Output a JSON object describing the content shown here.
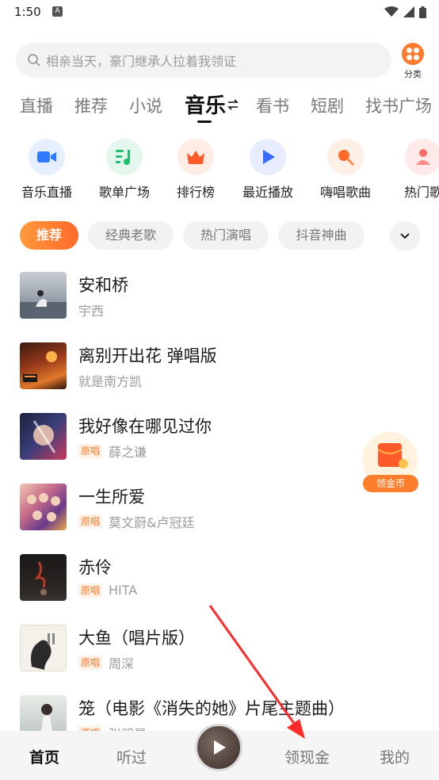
{
  "status_bar": {
    "time": "1:50",
    "notification_badge": "A"
  },
  "search": {
    "placeholder": "相亲当天，豪门继承人拉着我领证"
  },
  "category": {
    "label": "分类"
  },
  "tabs": [
    {
      "label": "直播"
    },
    {
      "label": "推荐"
    },
    {
      "label": "小说"
    },
    {
      "label": "音乐",
      "active": true
    },
    {
      "label": "看书"
    },
    {
      "label": "短剧"
    },
    {
      "label": "找书广场"
    }
  ],
  "shortcuts": [
    {
      "label": "音乐直播",
      "icon": "live-camera-icon",
      "color": "#2f7bff"
    },
    {
      "label": "歌单广场",
      "icon": "playlist-icon",
      "color": "#1fbf6b"
    },
    {
      "label": "排行榜",
      "icon": "crown-icon",
      "color": "#ff5a2a"
    },
    {
      "label": "最近播放",
      "icon": "play-triangle-icon",
      "color": "#3a6bff"
    },
    {
      "label": "嗨唱歌曲",
      "icon": "microphone-icon",
      "color": "#ff6a2a"
    },
    {
      "label": "热门歌",
      "icon": "hot-singer-icon",
      "color": "#ff6a6a"
    }
  ],
  "chips": [
    {
      "label": "推荐",
      "active": true
    },
    {
      "label": "经典老歌"
    },
    {
      "label": "热门演唱"
    },
    {
      "label": "抖音神曲"
    }
  ],
  "songs": [
    {
      "title": "安和桥",
      "artist": "宇西",
      "badge": ""
    },
    {
      "title": "离别开出花 弹唱版",
      "artist": "就是南方凯",
      "badge": ""
    },
    {
      "title": "我好像在哪见过你",
      "artist": "薛之谦",
      "badge": "原唱"
    },
    {
      "title": "一生所爱",
      "artist": "莫文蔚&卢冠廷",
      "badge": "原唱"
    },
    {
      "title": "赤伶",
      "artist": "HITA",
      "badge": "原唱"
    },
    {
      "title": "大鱼（唱片版）",
      "artist": "周深",
      "badge": "原唱"
    },
    {
      "title": "笼（电影《消失的她》片尾主题曲）",
      "artist": "张碧晨",
      "badge": "原唱"
    }
  ],
  "floating_reward": {
    "label": "领金币"
  },
  "bottom_nav": {
    "home": "首页",
    "listened": "听过",
    "cash": "领现金",
    "mine": "我的"
  },
  "colors": {
    "accent": "#ff6a2a",
    "annotation_arrow": "#ff2a2a"
  }
}
